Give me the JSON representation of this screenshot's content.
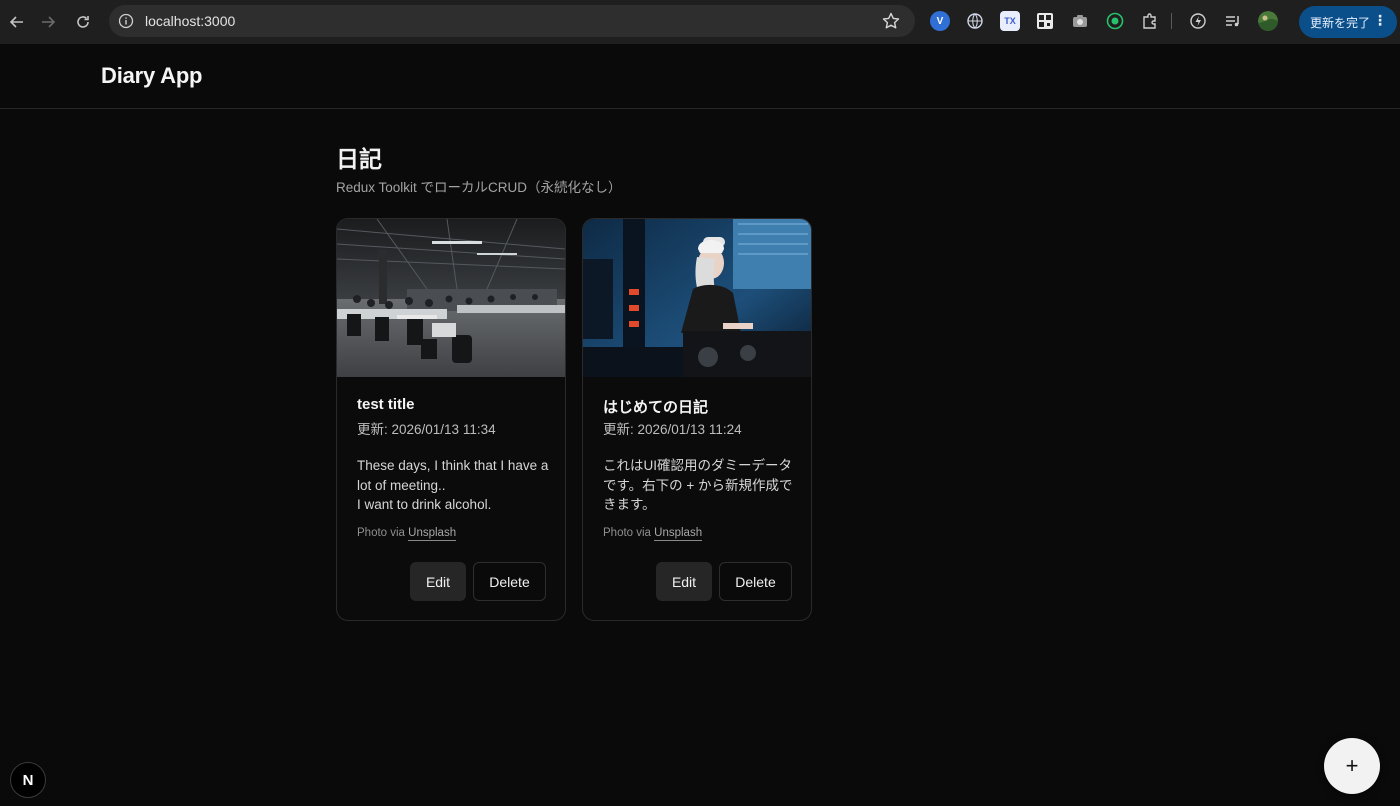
{
  "browser": {
    "url": "localhost:3000",
    "update_button": "更新を完了",
    "extensions": [
      "vpn-icon",
      "translate-icon",
      "tex-icon",
      "qr-icon",
      "camera-icon",
      "record-icon",
      "puzzle-icon",
      "flash-icon",
      "playlist-icon",
      "profile-avatar"
    ]
  },
  "header": {
    "app_title": "Diary App"
  },
  "main": {
    "heading": "日記",
    "subtitle": "Redux Toolkit でローカルCRUD（永続化なし）"
  },
  "entries": [
    {
      "title": "test title",
      "updated": "更新: 2026/01/13 11:34",
      "body": "These days, I think that I have a lot of meeting..\nI want to drink alcohol.",
      "photo": "office-photo",
      "credit_prefix": "Photo via",
      "credit_link": "Unsplash",
      "edit_label": "Edit",
      "delete_label": "Delete"
    },
    {
      "title": "はじめての日記",
      "updated": "更新: 2026/01/13 11:24",
      "body": "これはUI確認用のダミーデータです。右下の + から新規作成できます。",
      "photo": "dj-photo",
      "credit_prefix": "Photo via",
      "credit_link": "Unsplash",
      "edit_label": "Edit",
      "delete_label": "Delete"
    }
  ],
  "fab": {
    "label": "+"
  },
  "dev_badge": {
    "label": "N"
  },
  "colors": {
    "background": "#0a0a0a",
    "accent_update": "#0b4f8a",
    "fab": "#f2f2f2"
  }
}
